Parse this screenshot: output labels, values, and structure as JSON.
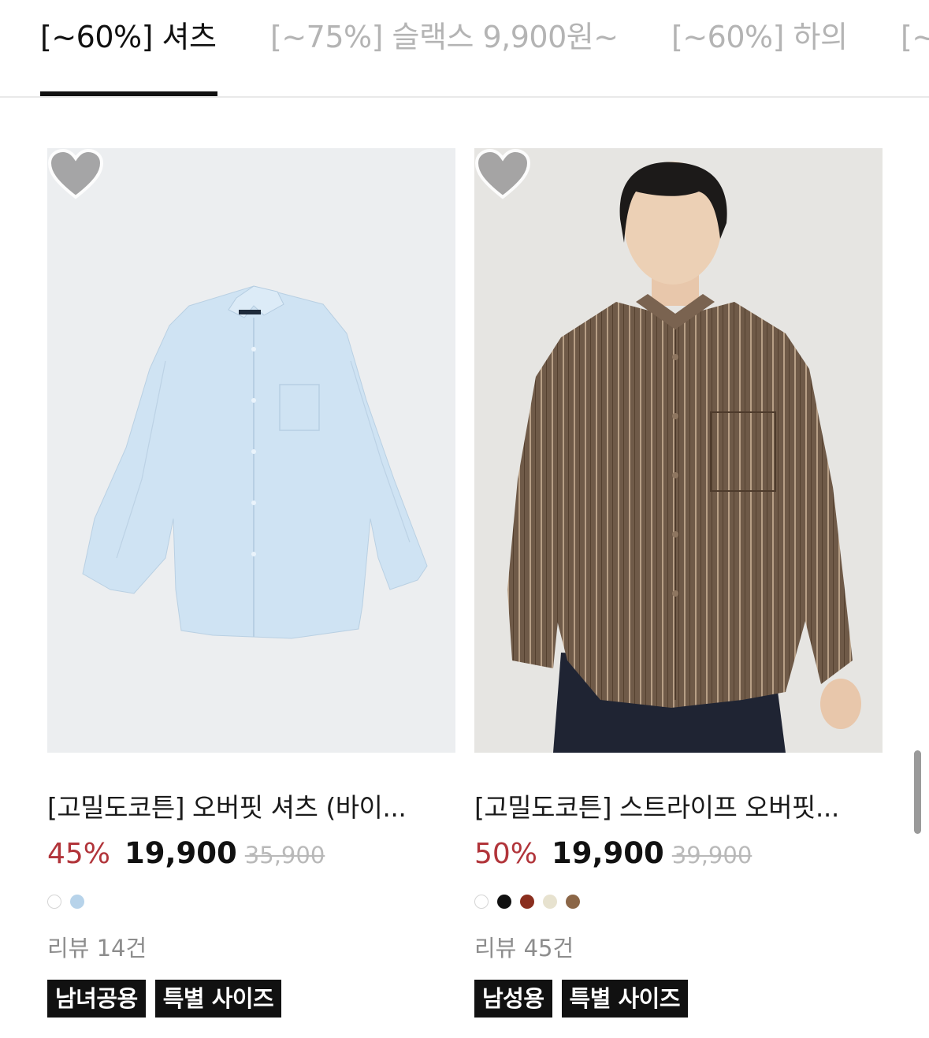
{
  "tabs": [
    {
      "label": "[~60%] 셔츠",
      "active": true
    },
    {
      "label": "[~75%] 슬랙스 9,900원~",
      "active": false
    },
    {
      "label": "[~60%] 하의",
      "active": false
    },
    {
      "label": "[~",
      "active": false
    }
  ],
  "products": [
    {
      "title": "[고밀도코튼] 오버핏 셔츠 (바이...",
      "discount": "45%",
      "price": "19,900",
      "original_price": "35,900",
      "colors": [
        "#ffffff",
        "#b7d3ea"
      ],
      "reviews": "리뷰 14건",
      "badges": [
        "남녀공용",
        "특별 사이즈"
      ],
      "wishlist_icon": "heart-icon"
    },
    {
      "title": "[고밀도코튼] 스트라이프 오버핏...",
      "discount": "50%",
      "price": "19,900",
      "original_price": "39,900",
      "colors": [
        "#ffffff",
        "#111111",
        "#8a2e1e",
        "#e7e2cf",
        "#8b6647"
      ],
      "reviews": "리뷰 45건",
      "badges": [
        "남성용",
        "특별 사이즈"
      ],
      "wishlist_icon": "heart-icon"
    }
  ],
  "colors": {
    "accent_discount": "#b1343a",
    "tab_active": "#111111",
    "tab_inactive": "#b4b4b4",
    "badge_bg": "#111111"
  }
}
